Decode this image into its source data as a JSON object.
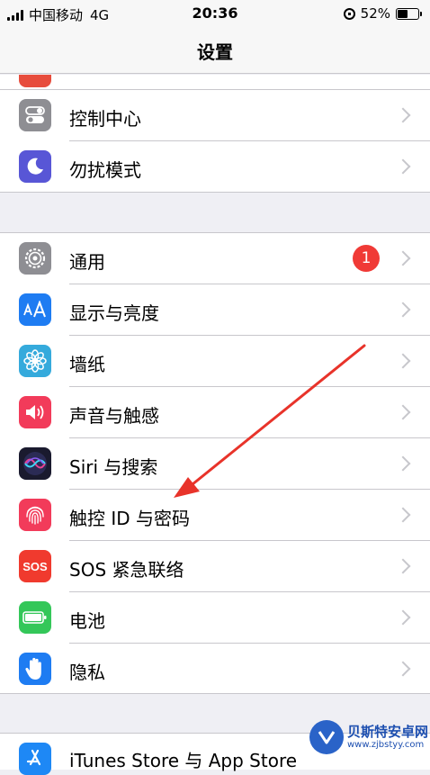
{
  "status_bar": {
    "carrier": "中国移动",
    "network": "4G",
    "time": "20:36",
    "battery": "52%",
    "battery_level": 0.52
  },
  "nav": {
    "title": "设置"
  },
  "group1": [
    {
      "label": "控制中心",
      "icon": "control-center-icon",
      "color": "#8e8e93"
    },
    {
      "label": "勿扰模式",
      "icon": "moon-icon",
      "color": "#5856d6"
    }
  ],
  "group2": [
    {
      "label": "通用",
      "icon": "gear-icon",
      "color": "#8e8e93",
      "badge": "1"
    },
    {
      "label": "显示与亮度",
      "icon": "display-brightness-icon",
      "color": "#1e7cf2"
    },
    {
      "label": "墙纸",
      "icon": "wallpaper-icon",
      "color": "#35aadc"
    },
    {
      "label": "声音与触感",
      "icon": "speaker-icon",
      "color": "#f23b5a"
    },
    {
      "label": "Siri 与搜索",
      "icon": "siri-icon",
      "color": "#1a1a2e"
    },
    {
      "label": "触控 ID 与密码",
      "icon": "fingerprint-icon",
      "color": "#f23b5a"
    },
    {
      "label": "SOS 紧急联络",
      "icon": "sos-icon",
      "color": "#f03a2e",
      "icon_text": "SOS"
    },
    {
      "label": "电池",
      "icon": "battery-icon",
      "color": "#34c759"
    },
    {
      "label": "隐私",
      "icon": "hand-icon",
      "color": "#1e7cf2"
    }
  ],
  "bottom": {
    "label": "iTunes Store 与 App Store",
    "icon": "app-store-icon",
    "color": "#1e88f5"
  },
  "watermark": {
    "line1": "贝斯特安卓网",
    "line2": "www.zjbstyy.com"
  },
  "annotation": {
    "arrow_color": "#e8332a"
  }
}
